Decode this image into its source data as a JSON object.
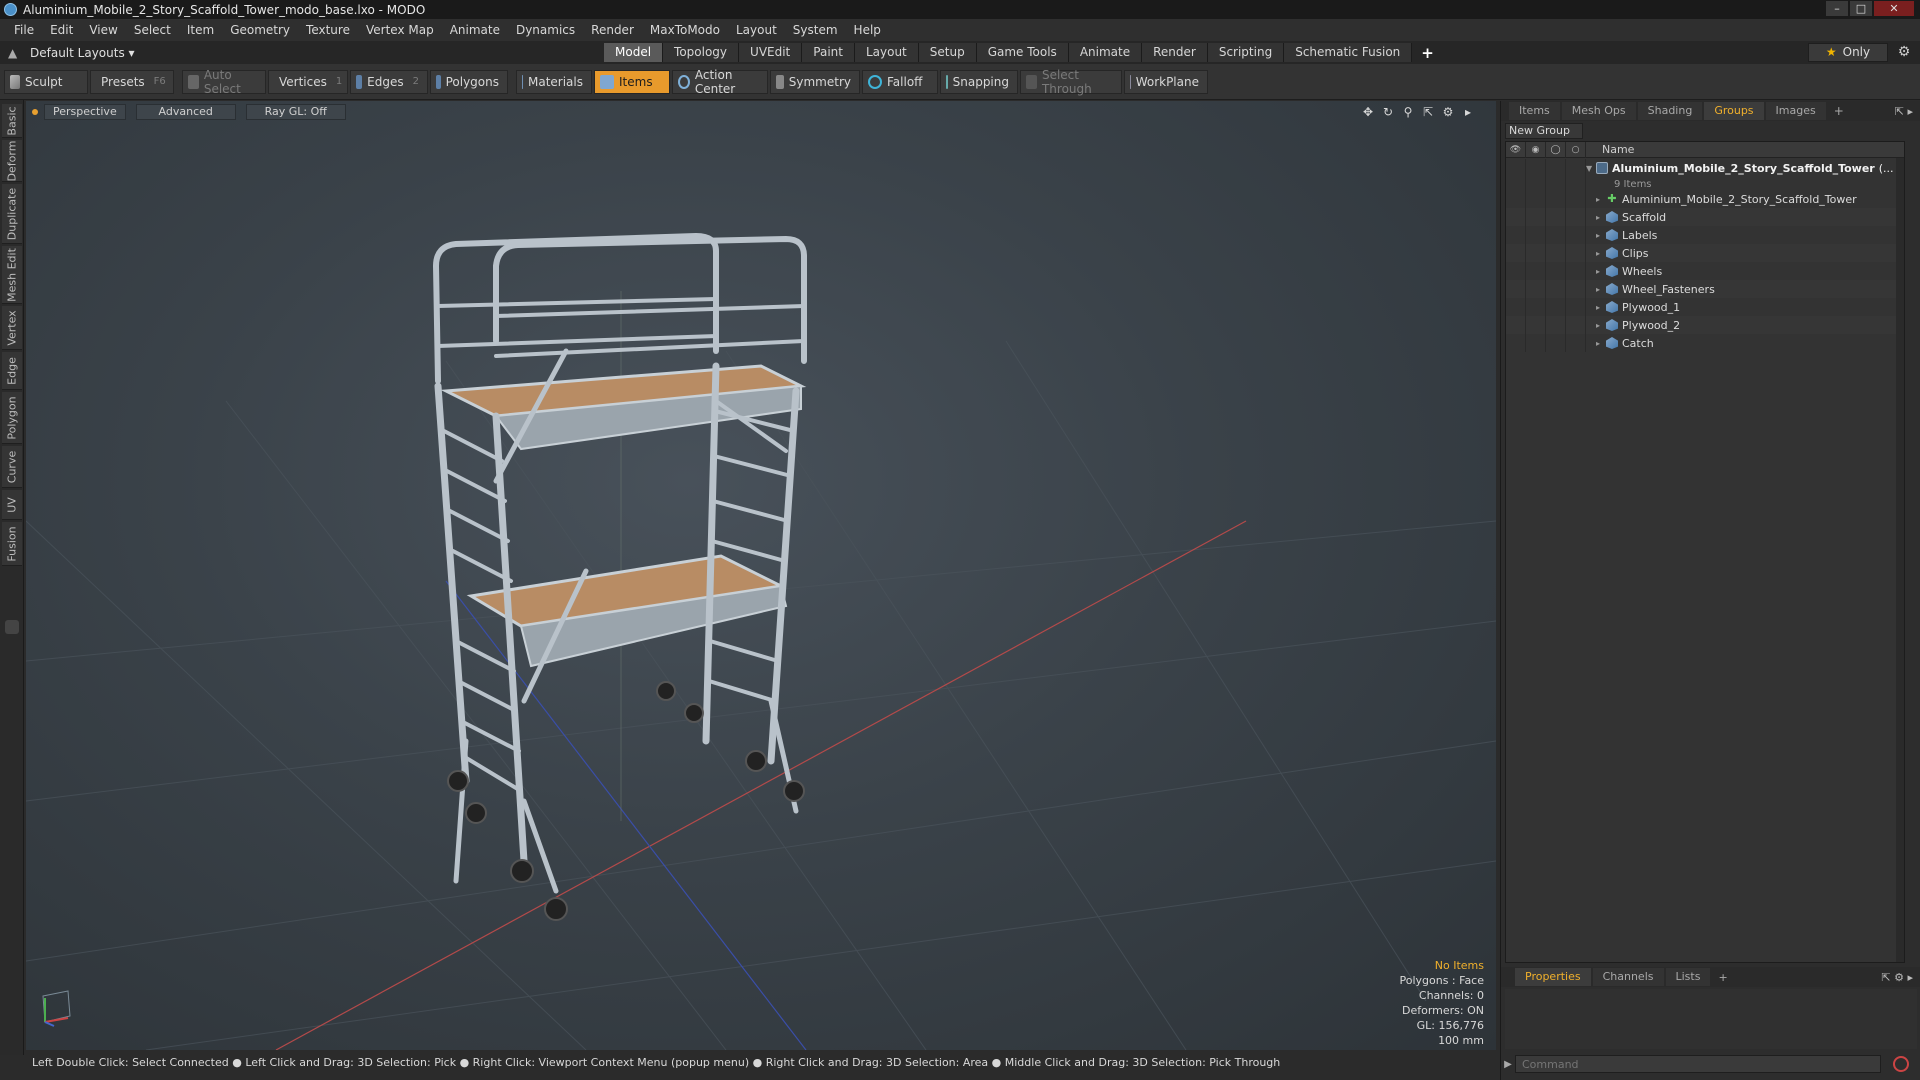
{
  "window": {
    "title": "Aluminium_Mobile_2_Story_Scaffold_Tower_modo_base.lxo - MODO",
    "controls": [
      "–",
      "□",
      "✕"
    ]
  },
  "menu": [
    "File",
    "Edit",
    "View",
    "Select",
    "Item",
    "Geometry",
    "Texture",
    "Vertex Map",
    "Animate",
    "Dynamics",
    "Render",
    "MaxToModo",
    "Layout",
    "System",
    "Help"
  ],
  "layoutbar": {
    "layouts_label": "Default Layouts ▾",
    "tabs": [
      "Model",
      "Topology",
      "UVEdit",
      "Paint",
      "Layout",
      "Setup",
      "Game Tools",
      "Animate",
      "Render",
      "Scripting",
      "Schematic Fusion"
    ],
    "active_tab": "Model",
    "plus": "+",
    "only_label": "Only"
  },
  "toolbar": {
    "sculpt": "Sculpt",
    "presets": "Presets",
    "presets_key": "F6",
    "auto_select": "Auto Select",
    "vertices": "Vertices",
    "vertices_count": "1",
    "edges": "Edges",
    "edges_count": "2",
    "polygons": "Polygons",
    "materials": "Materials",
    "items": "Items",
    "action_center": "Action Center",
    "symmetry": "Symmetry",
    "falloff": "Falloff",
    "snapping": "Snapping",
    "select_through": "Select Through",
    "workplane": "WorkPlane"
  },
  "left_tabs": [
    "Basic",
    "Deform",
    "Duplicate",
    "Mesh Edit",
    "Vertex",
    "Edge",
    "Polygon",
    "Curve",
    "UV",
    "Fusion"
  ],
  "viewport": {
    "view_mode": "Perspective",
    "shading": "Advanced",
    "raygl": "Ray GL: Off",
    "info": {
      "no_items": "No Items",
      "polygons": "Polygons : Face",
      "channels": "Channels: 0",
      "deformers": "Deformers: ON",
      "gl": "GL: 156,776",
      "unit": "100 mm"
    }
  },
  "statusbar": "Left Double Click: Select Connected ● Left Click and Drag: 3D Selection: Pick ● Right Click: Viewport Context Menu (popup menu) ● Right Click and Drag: 3D Selection: Area ● Middle Click and Drag: 3D Selection: Pick Through",
  "right_panel": {
    "tabs": [
      "Items",
      "Mesh Ops",
      "Shading",
      "Groups",
      "Images"
    ],
    "active_tab": "Groups",
    "new_group": "New Group",
    "column_name": "Name",
    "root": {
      "name": "Aluminium_Mobile_2_Story_Scaffold_Tower",
      "suffix": "(...",
      "count": "9 Items"
    },
    "children": [
      {
        "name": "Aluminium_Mobile_2_Story_Scaffold_Tower",
        "icon": "locator-icon"
      },
      {
        "name": "Scaffold",
        "icon": "mesh-icon"
      },
      {
        "name": "Labels",
        "icon": "mesh-icon"
      },
      {
        "name": "Clips",
        "icon": "mesh-icon"
      },
      {
        "name": "Wheels",
        "icon": "mesh-icon"
      },
      {
        "name": "Wheel_Fasteners",
        "icon": "mesh-icon"
      },
      {
        "name": "Plywood_1",
        "icon": "mesh-icon"
      },
      {
        "name": "Plywood_2",
        "icon": "mesh-icon"
      },
      {
        "name": "Catch",
        "icon": "mesh-icon"
      }
    ],
    "bottom_tabs": [
      "Properties",
      "Channels",
      "Lists"
    ],
    "bottom_active": "Properties",
    "command_placeholder": "Command"
  },
  "colors": {
    "accent": "#e89a2c",
    "active_text": "#f0b02c",
    "viewport_bg": "#3a4249"
  }
}
